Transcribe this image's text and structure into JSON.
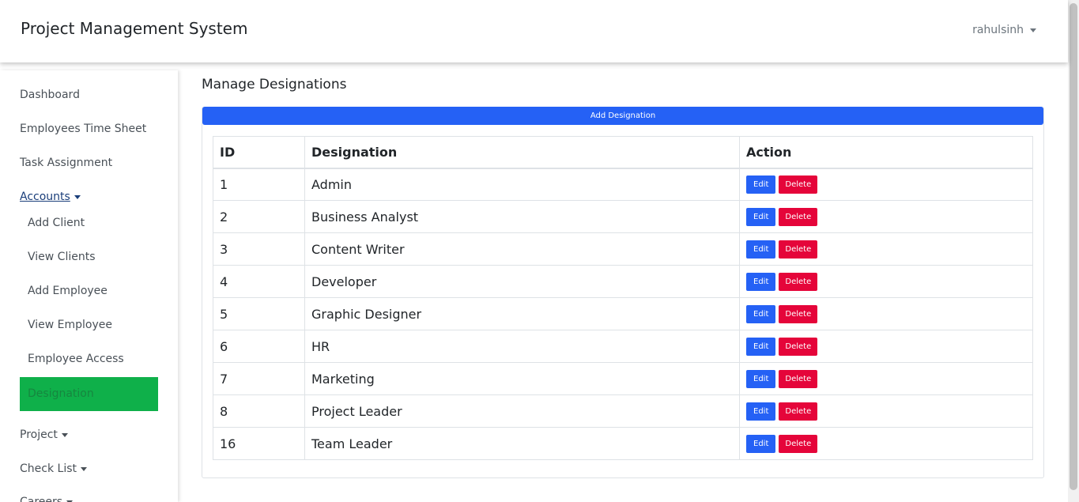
{
  "header": {
    "brand": "Project Management System",
    "user": "rahulsinh"
  },
  "sidebar": {
    "items": [
      {
        "label": "Dashboard"
      },
      {
        "label": "Employees Time Sheet"
      },
      {
        "label": "Task Assignment"
      },
      {
        "label": "Accounts"
      }
    ],
    "accounts_sub": [
      {
        "label": "Add Client"
      },
      {
        "label": "View Clients"
      },
      {
        "label": "Add Employee"
      },
      {
        "label": "View Employee"
      },
      {
        "label": "Employee Access"
      },
      {
        "label": "Designation"
      }
    ],
    "lower_items": [
      {
        "label": "Project"
      },
      {
        "label": "Check List"
      },
      {
        "label": "Careers"
      }
    ]
  },
  "main": {
    "title": "Manage Designations",
    "add_button": "Add Designation",
    "columns": [
      "ID",
      "Designation",
      "Action"
    ],
    "edit_label": "Edit",
    "delete_label": "Delete",
    "rows": [
      {
        "id": "1",
        "designation": "Admin"
      },
      {
        "id": "2",
        "designation": "Business Analyst"
      },
      {
        "id": "3",
        "designation": "Content Writer"
      },
      {
        "id": "4",
        "designation": "Developer"
      },
      {
        "id": "5",
        "designation": "Graphic Designer"
      },
      {
        "id": "6",
        "designation": "HR"
      },
      {
        "id": "7",
        "designation": "Marketing"
      },
      {
        "id": "8",
        "designation": "Project Leader"
      },
      {
        "id": "16",
        "designation": "Team Leader"
      }
    ]
  },
  "colors": {
    "primary": "#2561f5",
    "danger": "#e5053a",
    "active": "#0fb04a"
  }
}
